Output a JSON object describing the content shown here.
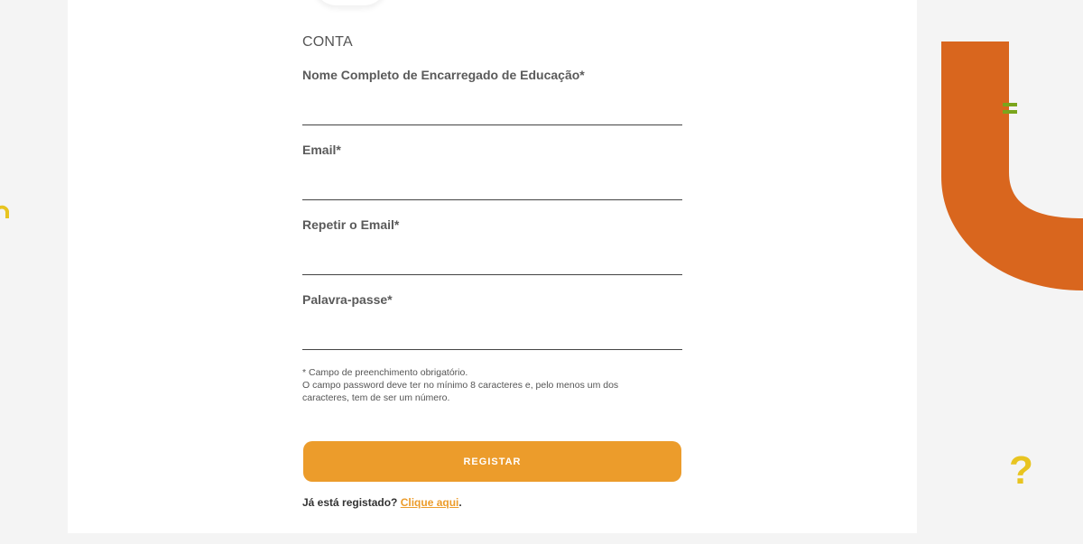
{
  "section_title": "CONTA",
  "fields": [
    {
      "label": "Nome Completo de Encarregado de Educação*",
      "value": "",
      "placeholder": ""
    },
    {
      "label": "Email*",
      "value": "",
      "placeholder": ""
    },
    {
      "label": "Repetir o Email*",
      "value": "",
      "placeholder": ""
    },
    {
      "label": "Palavra-passe*",
      "value": "",
      "placeholder": ""
    }
  ],
  "notes": {
    "required": "* Campo de preenchimento obrigatório.",
    "password_rule": "O campo password deve ter no mínimo 8 caracteres e, pelo menos um dos caracteres, tem de ser um número."
  },
  "submit_label": "REGISTAR",
  "login_prompt": {
    "text": "Já está registado?",
    "link_text": "Clique aqui",
    "suffix": "."
  },
  "decorations": {
    "question_mark": "?",
    "orange_color": "#d9661e",
    "green_color": "#7aa51c",
    "yellow_color": "#e8c420",
    "button_color": "#ec9c2b"
  }
}
